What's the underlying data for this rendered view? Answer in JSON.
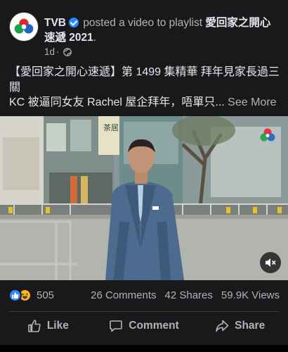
{
  "header": {
    "page_name": "TVB",
    "action_text": "posted a video to playlist",
    "playlist_name": "愛回家之開心速遞 2021",
    "period": ".",
    "time_ago": "1d",
    "dot_separator": "·",
    "privacy_icon": "globe-icon",
    "more_icon": "more-options-icon"
  },
  "caption": {
    "line1": "【愛回家之開心速遞】第 1499 集精華 拜年見家長過三關",
    "line2": "KC 被逼同女友 Rachel 屋企拜年，唔單只...",
    "see_more": "See More"
  },
  "video": {
    "shop_sign": "茶居",
    "watermark": "tvb-logo",
    "mute_icon": "muted-speaker-icon"
  },
  "stats": {
    "reaction_icons": [
      "like-reaction-icon",
      "haha-reaction-icon"
    ],
    "reaction_count": "505",
    "comments": "26 Comments",
    "shares": "42 Shares",
    "views": "59.9K Views"
  },
  "actions": {
    "like_label": "Like",
    "comment_label": "Comment",
    "share_label": "Share"
  },
  "colors": {
    "background": "#18191a",
    "primary_text": "#e4e6eb",
    "secondary_text": "#b0b3b8",
    "accent_blue": "#2d88ff",
    "haha_yellow": "#f7b928"
  }
}
